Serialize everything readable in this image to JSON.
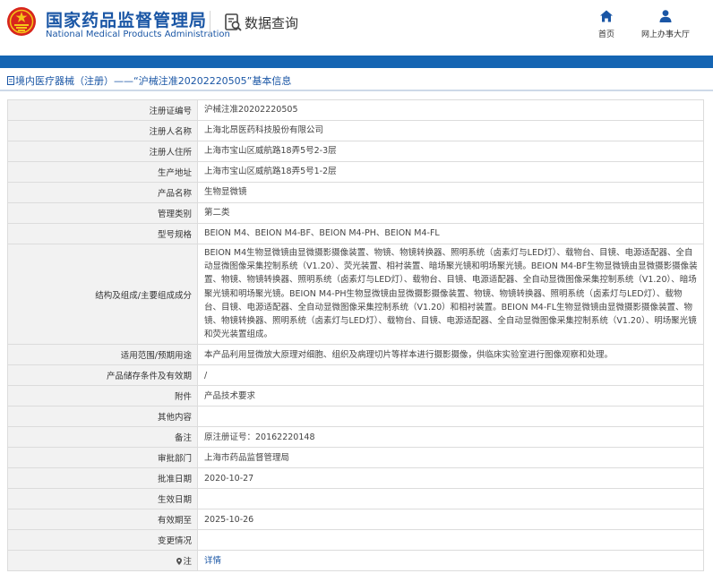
{
  "header": {
    "brand_cn": "国家药品监督管理局",
    "brand_en": "National Medical Products Administration",
    "section_title": "数据查询",
    "nav": [
      {
        "label": "首页",
        "icon": "home-icon"
      },
      {
        "label": "网上办事大厅",
        "icon": "user-icon"
      }
    ]
  },
  "colors": {
    "brand_blue": "#1a56a5",
    "bar_blue": "#1565b3",
    "label_bg": "#f2f2f2"
  },
  "breadcrumb": "境内医疗器械（注册）——“沪械注准20202220505”基本信息",
  "rows": [
    {
      "label": "注册证编号",
      "value": "沪械注准20202220505"
    },
    {
      "label": "注册人名称",
      "value": "上海北昂医药科技股份有限公司"
    },
    {
      "label": "注册人住所",
      "value": "上海市宝山区威航路18弄5号2-3层"
    },
    {
      "label": "生产地址",
      "value": "上海市宝山区威航路18弄5号1-2层"
    },
    {
      "label": "产品名称",
      "value": "生物显微镜"
    },
    {
      "label": "管理类别",
      "value": "第二类"
    },
    {
      "label": "型号规格",
      "value": "BEION M4、BEION M4-BF、BEION M4-PH、BEION M4-FL"
    },
    {
      "label": "结构及组成/主要组成成分",
      "value": "BEION M4生物显微镜由显微摄影摄像装置、物镜、物镜转换器、照明系统（卤素灯与LED灯）、载物台、目镜、电源适配器、全自动显微图像采集控制系统（V1.20）、荧光装置、相衬装置、暗场聚光镜和明场聚光镜。BEION M4-BF生物显微镜由显微摄影摄像装置、物镜、物镜转换器、照明系统（卤素灯与LED灯）、载物台、目镜、电源适配器、全自动显微图像采集控制系统（V1.20）、暗场聚光镜和明场聚光镜。BEION M4-PH生物显微镜由显微摄影摄像装置、物镜、物镜转换器、照明系统（卤素灯与LED灯）、载物台、目镜、电源适配器、全自动显微图像采集控制系统（V1.20）和相衬装置。BEION M4-FL生物显微镜由显微摄影摄像装置、物镜、物镜转换器、照明系统（卤素灯与LED灯）、载物台、目镜、电源适配器、全自动显微图像采集控制系统（V1.20）、明场聚光镜和荧光装置组成。",
      "tall": true
    },
    {
      "label": "适用范围/预期用途",
      "value": "本产品利用显微放大原理对细胞、组织及病理切片等样本进行摄影摄像，供临床实验室进行图像观察和处理。"
    },
    {
      "label": "产品储存条件及有效期",
      "value": "/"
    },
    {
      "label": "附件",
      "value": "产品技术要求"
    },
    {
      "label": "其他内容",
      "value": ""
    },
    {
      "label": "备注",
      "value": "原注册证号：20162220148"
    },
    {
      "label": "审批部门",
      "value": "上海市药品监督管理局"
    },
    {
      "label": "批准日期",
      "value": "2020-10-27"
    },
    {
      "label": "生效日期",
      "value": ""
    },
    {
      "label": "有效期至",
      "value": "2025-10-26"
    },
    {
      "label": "变更情况",
      "value": ""
    },
    {
      "label": "注",
      "value": "详情",
      "link": true,
      "icon": "pin-icon"
    }
  ]
}
